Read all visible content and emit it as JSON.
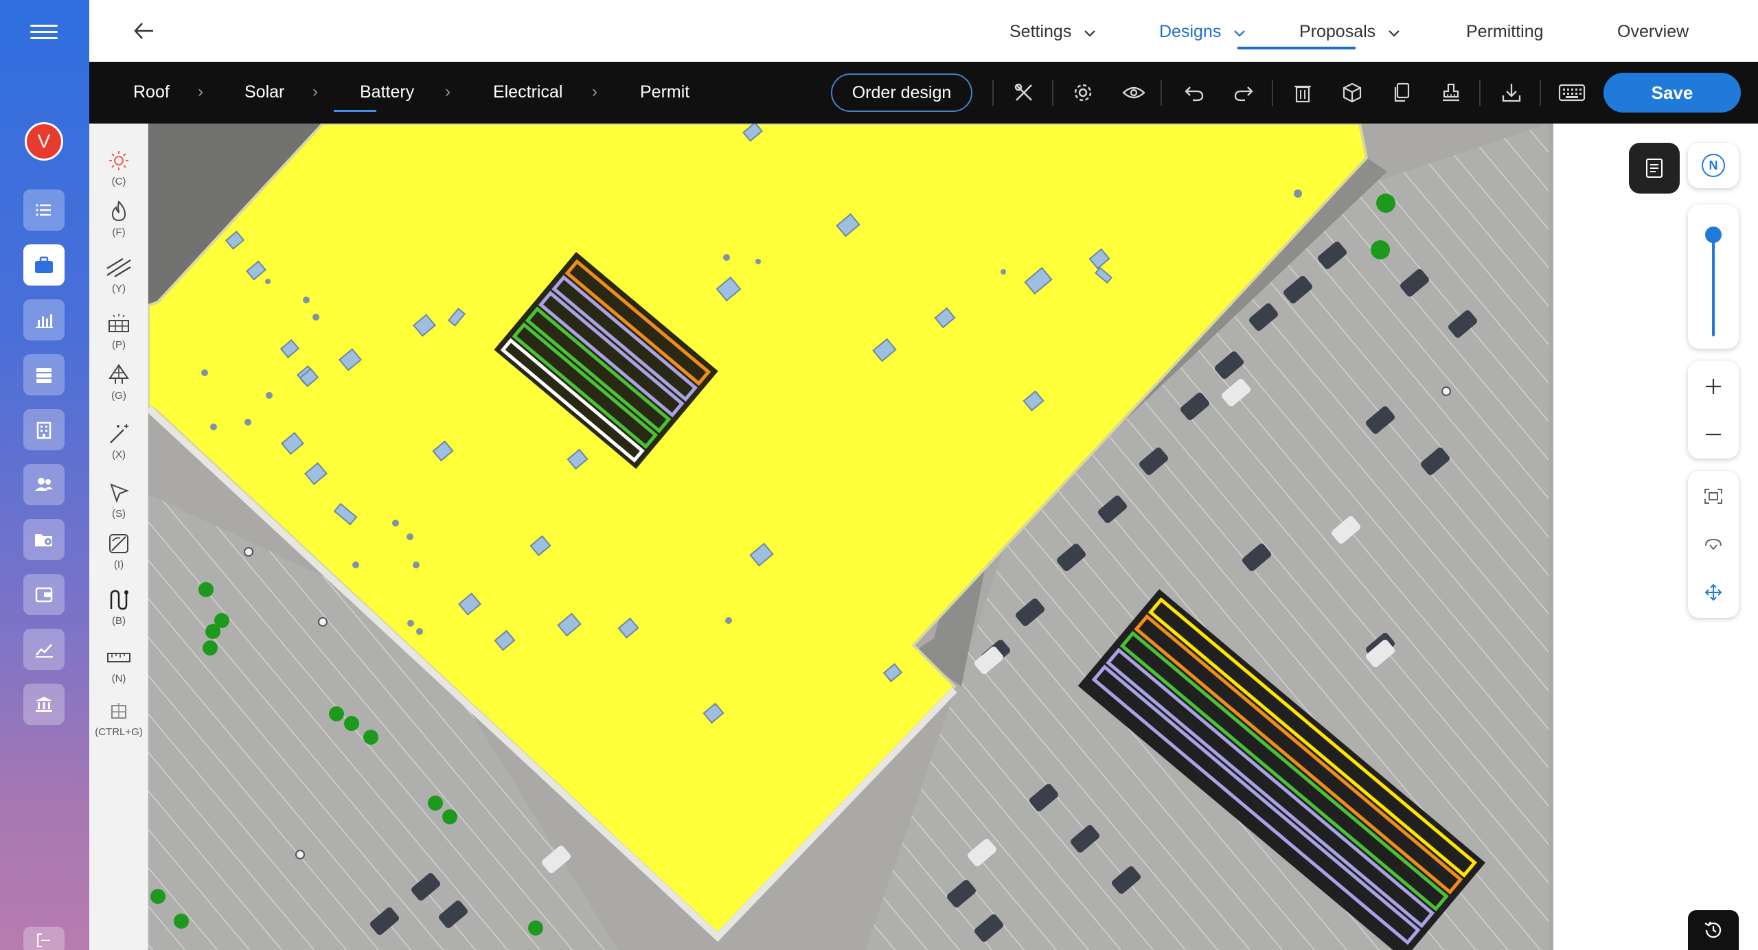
{
  "sidebar": {
    "avatar_letter": "V",
    "icons": [
      "menu-icon",
      "list-icon",
      "briefcase-icon",
      "bar-chart-icon",
      "database-icon",
      "building-icon",
      "users-icon",
      "folder-settings-icon",
      "wallet-icon",
      "analytics-icon",
      "bank-icon"
    ]
  },
  "header": {
    "tabs": [
      {
        "label": "Settings",
        "has_dropdown": true
      },
      {
        "label": "Designs",
        "has_dropdown": true,
        "active": true
      },
      {
        "label": "Proposals",
        "has_dropdown": true
      },
      {
        "label": "Permitting",
        "has_dropdown": false
      },
      {
        "label": "Overview",
        "has_dropdown": false
      }
    ]
  },
  "toolbar": {
    "breadcrumbs": [
      "Roof",
      "Solar",
      "Battery",
      "Electrical",
      "Permit"
    ],
    "active_breadcrumb": "Solar",
    "order_design_label": "Order design",
    "save_label": "Save",
    "icons": [
      "tools-icon",
      "settings-icon",
      "eye-icon",
      "undo-icon",
      "redo-icon",
      "trash-icon",
      "box-3d-icon",
      "copy-icon",
      "stamp-icon",
      "download-icon",
      "keyboard-icon"
    ]
  },
  "tools": [
    {
      "name": "sun-tool",
      "key": "(C)"
    },
    {
      "name": "fire-tool",
      "key": "(F)"
    },
    {
      "name": "setback-tool",
      "key": "(Y)"
    },
    {
      "name": "panel-tool",
      "key": "(P)"
    },
    {
      "name": "ground-mount-tool",
      "key": "(G)"
    },
    {
      "name": "magic-wand-tool",
      "key": "(X)"
    },
    {
      "name": "select-tool",
      "key": "(S)"
    },
    {
      "name": "irradiance-tool",
      "key": "(I)"
    },
    {
      "name": "string-tool",
      "key": "(B)"
    },
    {
      "name": "measure-tool",
      "key": "(N)"
    },
    {
      "name": "group-tool",
      "key": "(CTRL+G)"
    }
  ],
  "map_controls": {
    "compass_label": "N",
    "zoom_level": 0.08
  },
  "colors": {
    "accent": "#1f7ad9",
    "roof_highlight": "#ffff3a",
    "toolbar_bg": "#101010",
    "string_green": "#49c236",
    "string_purple": "#a9a3e6",
    "string_orange": "#f08c1a",
    "string_yellow": "#ffe500"
  }
}
